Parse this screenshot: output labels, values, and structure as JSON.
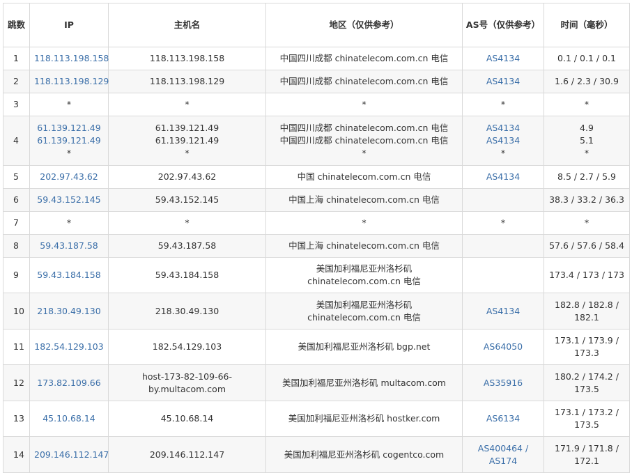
{
  "headers": {
    "hop": "跳数",
    "ip": "IP",
    "host": "主机名",
    "region": "地区（仅供参考）",
    "asn": "AS号（仅供参考）",
    "time": "时间（毫秒）"
  },
  "colors": {
    "link": "#3a6ea8",
    "border": "#d9d9d9",
    "alt_row": "#f7f7f7"
  },
  "rows": [
    {
      "hop": "1",
      "ip": [
        "118.113.198.158"
      ],
      "host": [
        "118.113.198.158"
      ],
      "region": [
        "中国四川成都 chinatelecom.com.cn 电信"
      ],
      "asn": [
        "AS4134"
      ],
      "time": [
        "0.1 / 0.1 / 0.1"
      ]
    },
    {
      "hop": "2",
      "ip": [
        "118.113.198.129"
      ],
      "host": [
        "118.113.198.129"
      ],
      "region": [
        "中国四川成都 chinatelecom.com.cn 电信"
      ],
      "asn": [
        "AS4134"
      ],
      "time": [
        "1.6 / 2.3 / 30.9"
      ]
    },
    {
      "hop": "3",
      "ip": [
        "*"
      ],
      "host": [
        "*"
      ],
      "region": [
        "*"
      ],
      "asn": [
        "*"
      ],
      "time": [
        "*"
      ]
    },
    {
      "hop": "4",
      "ip": [
        "61.139.121.49",
        "61.139.121.49",
        "*"
      ],
      "host": [
        "61.139.121.49",
        "61.139.121.49",
        "*"
      ],
      "region": [
        "中国四川成都 chinatelecom.com.cn 电信",
        "中国四川成都 chinatelecom.com.cn 电信",
        "*"
      ],
      "asn": [
        "AS4134",
        "AS4134",
        "*"
      ],
      "time": [
        "4.9",
        "5.1",
        "*"
      ]
    },
    {
      "hop": "5",
      "ip": [
        "202.97.43.62"
      ],
      "host": [
        "202.97.43.62"
      ],
      "region": [
        "中国 chinatelecom.com.cn 电信"
      ],
      "asn": [
        "AS4134"
      ],
      "time": [
        "8.5 / 2.7 / 5.9"
      ]
    },
    {
      "hop": "6",
      "ip": [
        "59.43.152.145"
      ],
      "host": [
        "59.43.152.145"
      ],
      "region": [
        "中国上海 chinatelecom.com.cn 电信"
      ],
      "asn": [],
      "time": [
        "38.3 / 33.2 / 36.3"
      ]
    },
    {
      "hop": "7",
      "ip": [
        "*"
      ],
      "host": [
        "*"
      ],
      "region": [
        "*"
      ],
      "asn": [
        "*"
      ],
      "time": [
        "*"
      ]
    },
    {
      "hop": "8",
      "ip": [
        "59.43.187.58"
      ],
      "host": [
        "59.43.187.58"
      ],
      "region": [
        "中国上海 chinatelecom.com.cn 电信"
      ],
      "asn": [],
      "time": [
        "57.6 / 57.6 / 58.4"
      ]
    },
    {
      "hop": "9",
      "ip": [
        "59.43.184.158"
      ],
      "host": [
        "59.43.184.158"
      ],
      "region": [
        "美国加利福尼亚州洛杉矶",
        "chinatelecom.com.cn 电信"
      ],
      "asn": [],
      "time": [
        "173.4 / 173 / 173"
      ]
    },
    {
      "hop": "10",
      "ip": [
        "218.30.49.130"
      ],
      "host": [
        "218.30.49.130"
      ],
      "region": [
        "美国加利福尼亚州洛杉矶",
        "chinatelecom.com.cn 电信"
      ],
      "asn": [
        "AS4134"
      ],
      "time": [
        "182.8 / 182.8 /",
        "182.1"
      ]
    },
    {
      "hop": "11",
      "ip": [
        "182.54.129.103"
      ],
      "host": [
        "182.54.129.103"
      ],
      "region": [
        "美国加利福尼亚州洛杉矶 bgp.net"
      ],
      "asn": [
        "AS64050"
      ],
      "time": [
        "173.1 / 173.9 /",
        "173.3"
      ]
    },
    {
      "hop": "12",
      "ip": [
        "173.82.109.66"
      ],
      "host": [
        "host-173-82-109-66-",
        "by.multacom.com"
      ],
      "region": [
        "美国加利福尼亚州洛杉矶 multacom.com"
      ],
      "asn": [
        "AS35916"
      ],
      "time": [
        "180.2 / 174.2 /",
        "173.5"
      ]
    },
    {
      "hop": "13",
      "ip": [
        "45.10.68.14"
      ],
      "host": [
        "45.10.68.14"
      ],
      "region": [
        "美国加利福尼亚州洛杉矶 hostker.com"
      ],
      "asn": [
        "AS6134"
      ],
      "time": [
        "173.1 / 173.2 /",
        "173.5"
      ]
    },
    {
      "hop": "14",
      "ip": [
        "209.146.112.147"
      ],
      "host": [
        "209.146.112.147"
      ],
      "region": [
        "美国加利福尼亚州洛杉矶 cogentco.com"
      ],
      "asn": [
        "AS400464 /",
        "AS174"
      ],
      "time": [
        "171.9 / 171.8 /",
        "172.1"
      ]
    }
  ]
}
